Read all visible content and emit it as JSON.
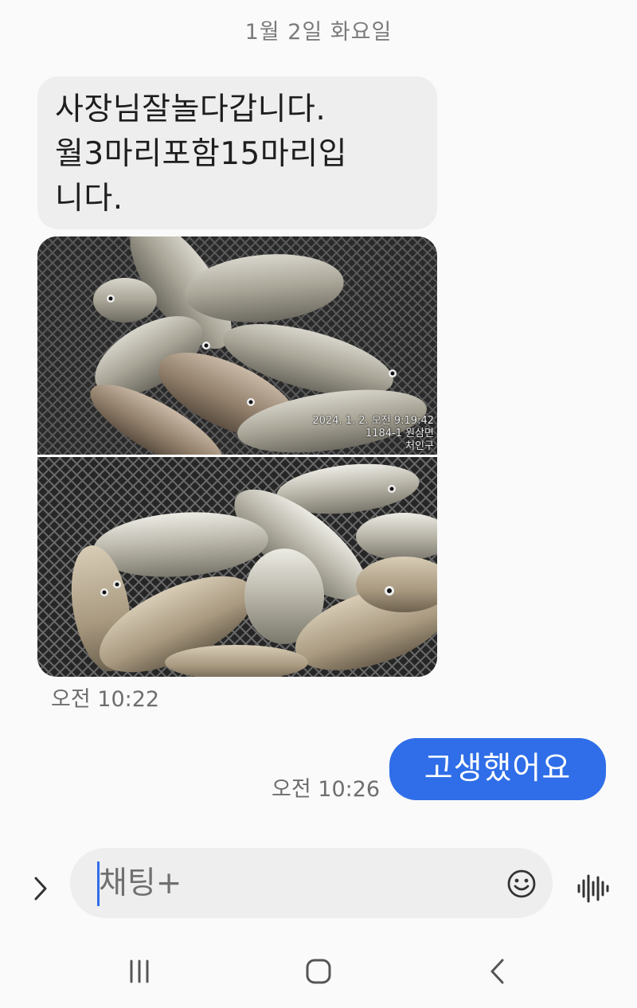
{
  "conversation": {
    "date_header": "1월 2일 화요일",
    "messages": [
      {
        "direction": "incoming",
        "text": "사장님잘놀다갑니다.\n월3마리포함15마리입\n니다.",
        "photos": [
          {
            "stamp_lines": [
              "2024. 1. 2. 오전 9:19:42",
              "1184-1 원삼면",
              "처인구"
            ]
          },
          {
            "stamp_lines": []
          }
        ],
        "time": "오전 10:22"
      },
      {
        "direction": "outgoing",
        "text": "고생했어요",
        "time": "오전 10:26"
      }
    ]
  },
  "composer": {
    "placeholder": "채팅+",
    "icons": [
      "chevron-right-icon",
      "smiley-icon",
      "voice-wave-icon"
    ]
  },
  "navigation": {
    "icons": [
      "recent-apps-icon",
      "home-icon",
      "back-icon"
    ]
  },
  "colors": {
    "outgoing_bubble": "#2f6ee8",
    "incoming_bubble": "#eeeeee",
    "background": "#fafafa"
  }
}
